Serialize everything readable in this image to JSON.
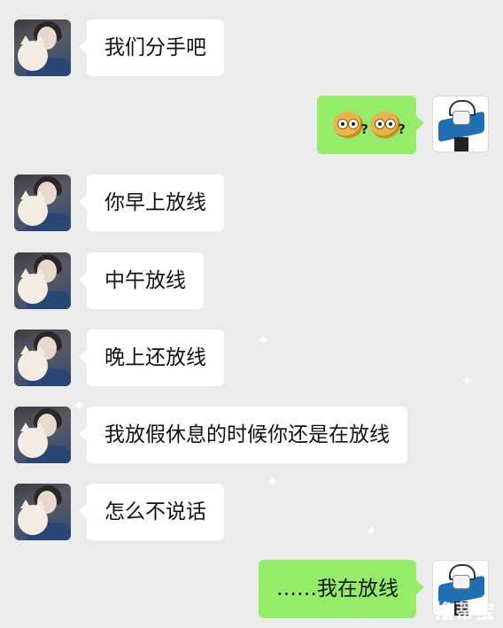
{
  "chat": {
    "messages": [
      {
        "side": "left",
        "text": "我们分手吧"
      },
      {
        "side": "right",
        "emoji": [
          "confused-emoji",
          "confused-emoji"
        ]
      },
      {
        "side": "left",
        "text": "你早上放线"
      },
      {
        "side": "left",
        "text": "中午放线"
      },
      {
        "side": "left",
        "text": "晚上还放线"
      },
      {
        "side": "left",
        "text": "我放假休息的时候你还是在放线"
      },
      {
        "side": "left",
        "text": "怎么不说话"
      },
      {
        "side": "right",
        "text": "……我在放线"
      }
    ]
  },
  "emoji_symbol": "?",
  "watermark": "撸蒂宝",
  "colors": {
    "background": "#ebebeb",
    "left_bubble": "#ffffff",
    "right_bubble": "#95ec69"
  }
}
